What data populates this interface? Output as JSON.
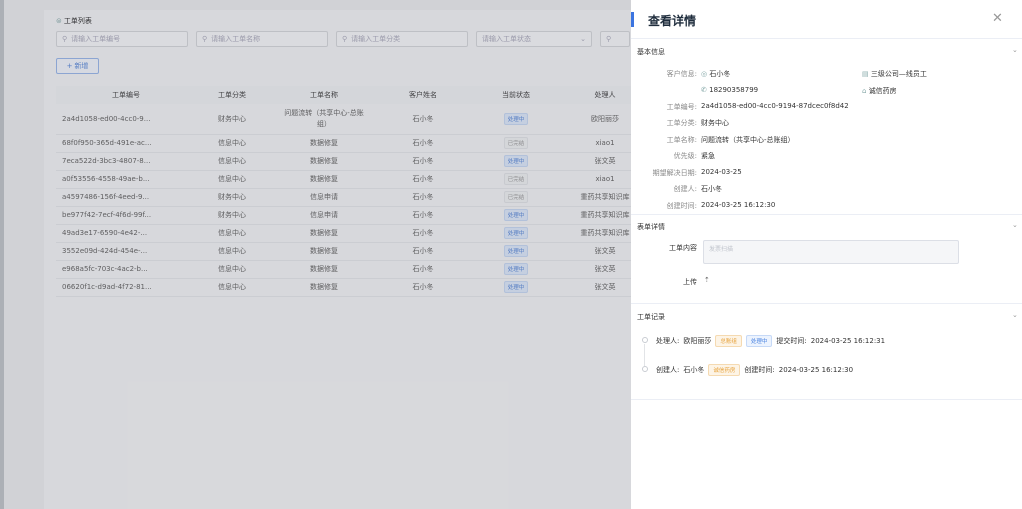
{
  "list": {
    "section_title": "工单列表",
    "filters": {
      "order_no": "请输入工单编号",
      "order_name": "请输入工单名称",
      "order_category": "请输入工单分类",
      "order_status": "请输入工单状态"
    },
    "add_button": "新增",
    "columns": [
      "工单编号",
      "工单分类",
      "工单名称",
      "客户姓名",
      "当前状态",
      "处理人"
    ],
    "rows": [
      {
        "no": "2a4d1058-ed00-4cc0-9...",
        "category": "财务中心",
        "name": "问题流转（共享中心-总账组）",
        "customer": "石小冬",
        "status": "处理中",
        "handler": "欧阳丽莎"
      },
      {
        "no": "68f0f950-365d-491e-ac...",
        "category": "信息中心",
        "name": "数据修复",
        "customer": "石小冬",
        "status": "已完结",
        "handler": "xiao1"
      },
      {
        "no": "7eca522d-3bc3-4807-8...",
        "category": "信息中心",
        "name": "数据修复",
        "customer": "石小冬",
        "status": "处理中",
        "handler": "张文英"
      },
      {
        "no": "a0f53556-4558-49ae-b...",
        "category": "信息中心",
        "name": "数据修复",
        "customer": "石小冬",
        "status": "已完结",
        "handler": "xiao1"
      },
      {
        "no": "a4597486-156f-4eed-9...",
        "category": "财务中心",
        "name": "信息申请",
        "customer": "石小冬",
        "status": "已完结",
        "handler": "重药共享知识库"
      },
      {
        "no": "be977f42-7ecf-4f6d-99f...",
        "category": "财务中心",
        "name": "信息申请",
        "customer": "石小冬",
        "status": "处理中",
        "handler": "重药共享知识库"
      },
      {
        "no": "49ad3e17-6590-4e42-...",
        "category": "信息中心",
        "name": "数据修复",
        "customer": "石小冬",
        "status": "处理中",
        "handler": "重药共享知识库"
      },
      {
        "no": "3552e09d-424d-454e-...",
        "category": "信息中心",
        "name": "数据修复",
        "customer": "石小冬",
        "status": "处理中",
        "handler": "张文英"
      },
      {
        "no": "e968a5fc-703c-4ac2-b...",
        "category": "信息中心",
        "name": "数据修复",
        "customer": "石小冬",
        "status": "处理中",
        "handler": "张文英"
      },
      {
        "no": "06620f1c-d9ad-4f72-81...",
        "category": "信息中心",
        "name": "数据修复",
        "customer": "石小冬",
        "status": "处理中",
        "handler": "张文英"
      }
    ]
  },
  "drawer": {
    "title": "查看详情",
    "basic": {
      "heading": "基本信息",
      "customer_label": "客户信息:",
      "customer_name": "石小冬",
      "customer_phone": "18290358799",
      "customer_company": "三级公司—线员工",
      "customer_org": "诚信药房",
      "order_no_label": "工单编号:",
      "order_no": "2a4d1058-ed00-4cc0-9194-87dcec0f8d42",
      "category_label": "工单分类:",
      "category": "财务中心",
      "name_label": "工单名称:",
      "name": "问题流转（共享中心-总账组）",
      "priority_label": "优先级:",
      "priority": "紧急",
      "expected_label": "期望解决日期:",
      "expected": "2024-03-25",
      "creator_label": "创建人:",
      "creator": "石小冬",
      "created_label": "创建时间:",
      "created": "2024-03-25 16:12:30"
    },
    "form": {
      "heading": "表单详情",
      "content_label": "工单内容",
      "content_placeholder": "发票扫描",
      "upload_label": "上传"
    },
    "records": {
      "heading": "工单记录",
      "items": [
        {
          "role": "处理人:",
          "person": "欧阳丽莎",
          "tag1": "总账组",
          "tag2": "处理中",
          "time_label": "提交时间:",
          "time": "2024-03-25 16:12:31"
        },
        {
          "role": "创建人:",
          "person": "石小冬",
          "tag1": "诚信药房",
          "time_label": "创建时间:",
          "time": "2024-03-25 16:12:30"
        }
      ]
    }
  }
}
